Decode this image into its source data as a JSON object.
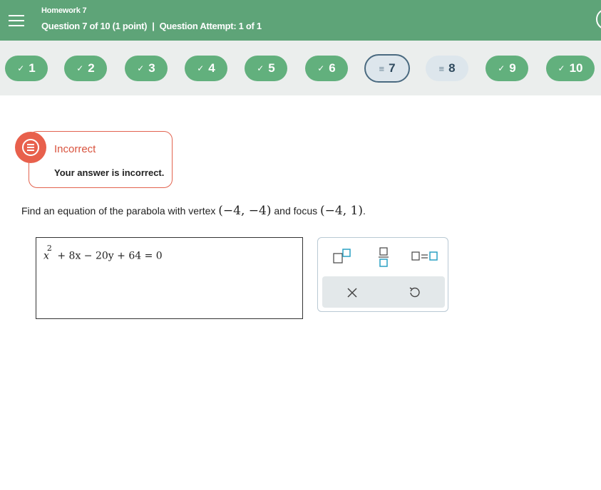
{
  "header": {
    "homework_title": "Homework 7",
    "question_info": "Question 7 of 10 (1 point)",
    "separator": "|",
    "attempt_info": "Question Attempt: 1 of 1",
    "menu_icon": "hamburger-menu-icon",
    "background_color": "#5ea478"
  },
  "question_nav": [
    {
      "number": "1",
      "status": "done",
      "glyph": "✓"
    },
    {
      "number": "2",
      "status": "done",
      "glyph": "✓"
    },
    {
      "number": "3",
      "status": "done",
      "glyph": "✓"
    },
    {
      "number": "4",
      "status": "done",
      "glyph": "✓"
    },
    {
      "number": "5",
      "status": "done",
      "glyph": "✓"
    },
    {
      "number": "6",
      "status": "done",
      "glyph": "✓"
    },
    {
      "number": "7",
      "status": "current",
      "glyph": "≡"
    },
    {
      "number": "8",
      "status": "pending",
      "glyph": "≡"
    },
    {
      "number": "9",
      "status": "done",
      "glyph": "✓"
    },
    {
      "number": "10",
      "status": "done",
      "glyph": "✓"
    }
  ],
  "feedback": {
    "title": "Incorrect",
    "message": "Your answer is incorrect.",
    "icon": "feedback-message-icon",
    "color": "#e8604c"
  },
  "question": {
    "text_before": "Find an equation of the parabola with vertex ",
    "vertex": "(−4, −4)",
    "text_middle": " and focus ",
    "focus": "(−4, 1)",
    "text_after": "."
  },
  "answer": {
    "var_x": "x",
    "exponent": "2",
    "rest": " + 8x − 20y + 64 = 0"
  },
  "palette": {
    "buttons": [
      "superscript-icon",
      "fraction-icon",
      "equation-icon",
      "clear-icon",
      "undo-icon"
    ]
  }
}
